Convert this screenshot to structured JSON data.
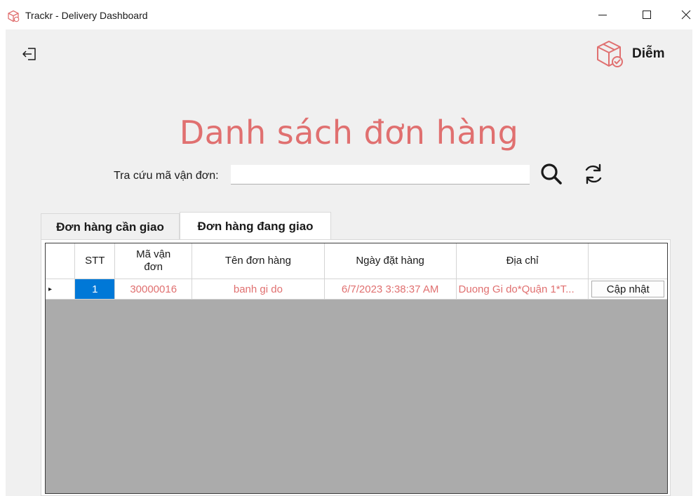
{
  "window": {
    "title": "Trackr - Delivery Dashboard",
    "icon": "package-icon",
    "controls": [
      "minimize-icon",
      "maximize-icon",
      "close-icon"
    ]
  },
  "header": {
    "logout_icon": "logout-icon",
    "user_icon": "package-check-icon",
    "user_name": "Diễm"
  },
  "main": {
    "title": "Danh sách đơn hàng",
    "search": {
      "label": "Tra cứu mã vận đơn:",
      "value": "",
      "search_icon": "search-icon",
      "refresh_icon": "refresh-icon"
    },
    "tabs": [
      {
        "label": "Đơn hàng cần giao",
        "active": false
      },
      {
        "label": "Đơn hàng đang giao",
        "active": true
      }
    ],
    "table": {
      "columns": [
        "STT",
        "Mã vận đơn",
        "Tên đơn hàng",
        "Ngày đặt hàng",
        "Địa chỉ",
        ""
      ],
      "rows": [
        {
          "stt": "1",
          "ma_van_don": "30000016",
          "ten_don_hang": "banh gi do",
          "ngay_dat_hang": "6/7/2023 3:38:37 AM",
          "dia_chi": "Duong Gi do*Quận 1*T...",
          "action": "Cập nhật"
        }
      ]
    }
  },
  "colors": {
    "accent": "#e07070",
    "selection": "#0078d7",
    "grid_background": "#ababab",
    "window_background": "#f0f0f0"
  }
}
